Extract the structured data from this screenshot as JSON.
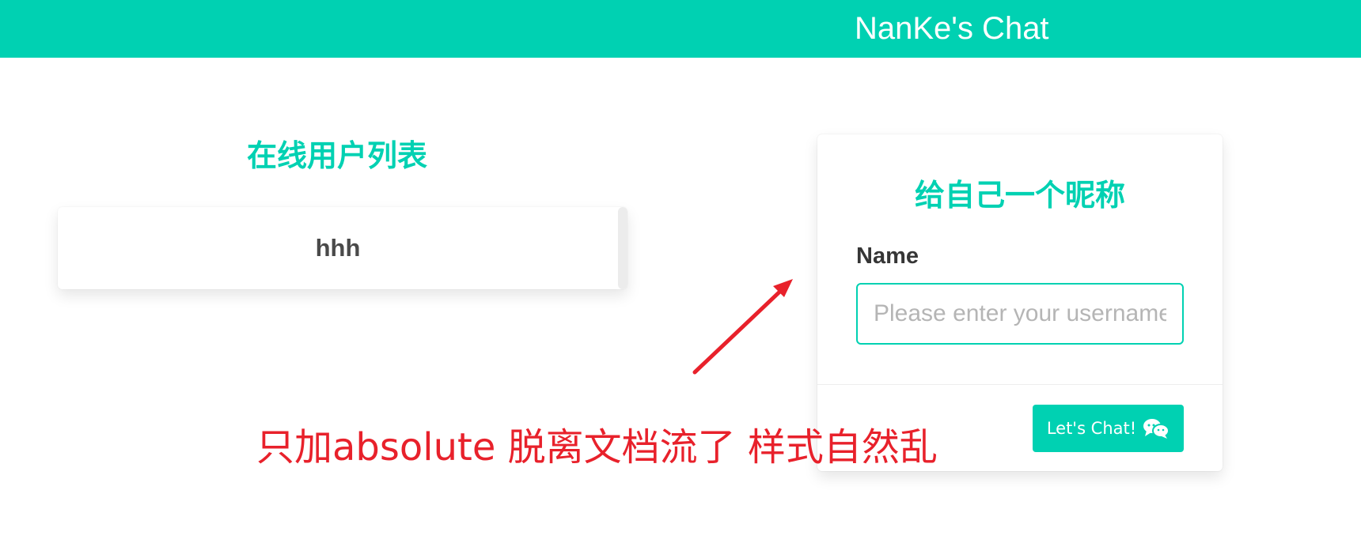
{
  "header": {
    "title": "NanKe's Chat"
  },
  "online_users": {
    "heading": "在线用户列表",
    "users": [
      "hhh"
    ]
  },
  "nickname_card": {
    "title": "给自己一个昵称",
    "name_label": "Name",
    "name_input_value": "",
    "name_input_placeholder": "Please enter your username",
    "submit_label": "Let's Chat!",
    "submit_icon": "chat-bubbles-icon"
  },
  "annotation": {
    "text": "只加absolute 脱离文档流了 样式自然乱"
  },
  "colors": {
    "brand": "#00d1b2",
    "annotation": "#e8212b",
    "text_dark": "#363636",
    "placeholder": "#b5b5b5"
  }
}
